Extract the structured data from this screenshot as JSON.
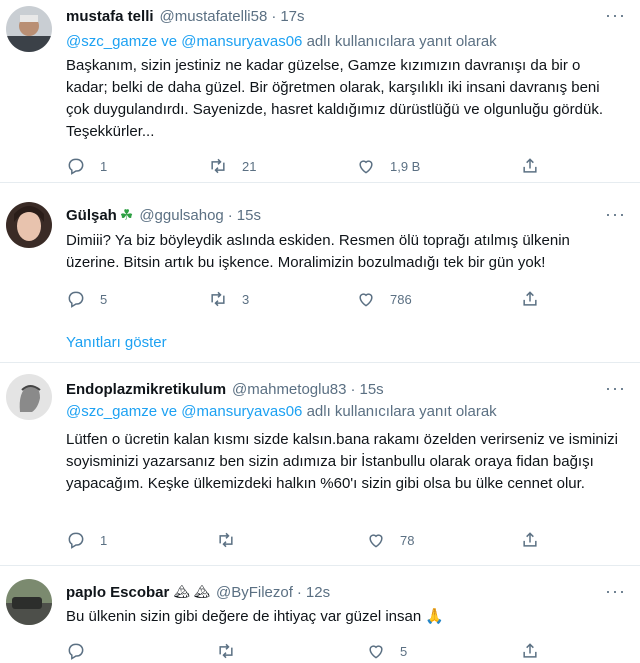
{
  "tweets": [
    {
      "name": "mustafa telli",
      "handle": "@mustafatelli58",
      "time": "17s",
      "reply_to": {
        "mention1": "@szc_gamze",
        "connector": "ve",
        "mention2": "@mansuryavas06",
        "suffix": "adlı kullanıcılara yanıt olarak"
      },
      "text": "Başkanım, sizin jestiniz ne kadar güzelse, Gamze kızımızın davranışı da bir o kadar; belki de daha güzel. Bir öğretmen olarak, karşılıklı iki insani davranış beni çok duygulandırdı. Sayenizde, hasret kaldığımız dürüstlüğü ve olgunluğu gördük. Teşekkürler...",
      "replies": "1",
      "retweets": "21",
      "likes": "1,9 B"
    },
    {
      "name": "Gülşah",
      "name_emoji": "☘",
      "handle": "@ggulsahog",
      "time": "15s",
      "text": "Dimiii? Ya biz böyleydik aslında eskiden. Resmen ölü toprağı atılmış ülkenin üzerine. Bitsin artık bu işkence. Moralimizin bozulmadığı tek bir gün yok!",
      "replies": "5",
      "retweets": "3",
      "likes": "786",
      "show_replies": "Yanıtları göster"
    },
    {
      "name": "Endoplazmikretikulum",
      "handle": "@mahmetoglu83",
      "time": "15s",
      "reply_to": {
        "mention1": "@szc_gamze",
        "connector": "ve",
        "mention2": "@mansuryavas06",
        "suffix": "adlı kullanıcılara yanıt olarak"
      },
      "text": "Lütfen o ücretin kalan kısmı sizde kalsın.bana rakamı özelden verirseniz ve isminizi soyisminizi yazarsanız ben sizin adımıza bir İstanbullu olarak oraya fidan bağışı yapacağım. Keşke ülkemizdeki halkın %60'ı sizin gibi olsa bu ülke cennet olur.",
      "replies": "1",
      "retweets": "",
      "likes": "78"
    },
    {
      "name": "paplo Escobar",
      "name_emoji": "🏔 🏔",
      "handle": "@ByFilezof",
      "time": "12s",
      "text": "Bu ülkenin sizin gibi değere de ihtiyaç var güzel insan 🙏",
      "replies": "",
      "retweets": "",
      "likes": "5"
    }
  ],
  "separator": "·",
  "more_symbol": "···",
  "colors": {
    "link": "#1da1f2",
    "muted": "#5b7083",
    "text": "#0f1419",
    "border": "#e6ecf0"
  }
}
